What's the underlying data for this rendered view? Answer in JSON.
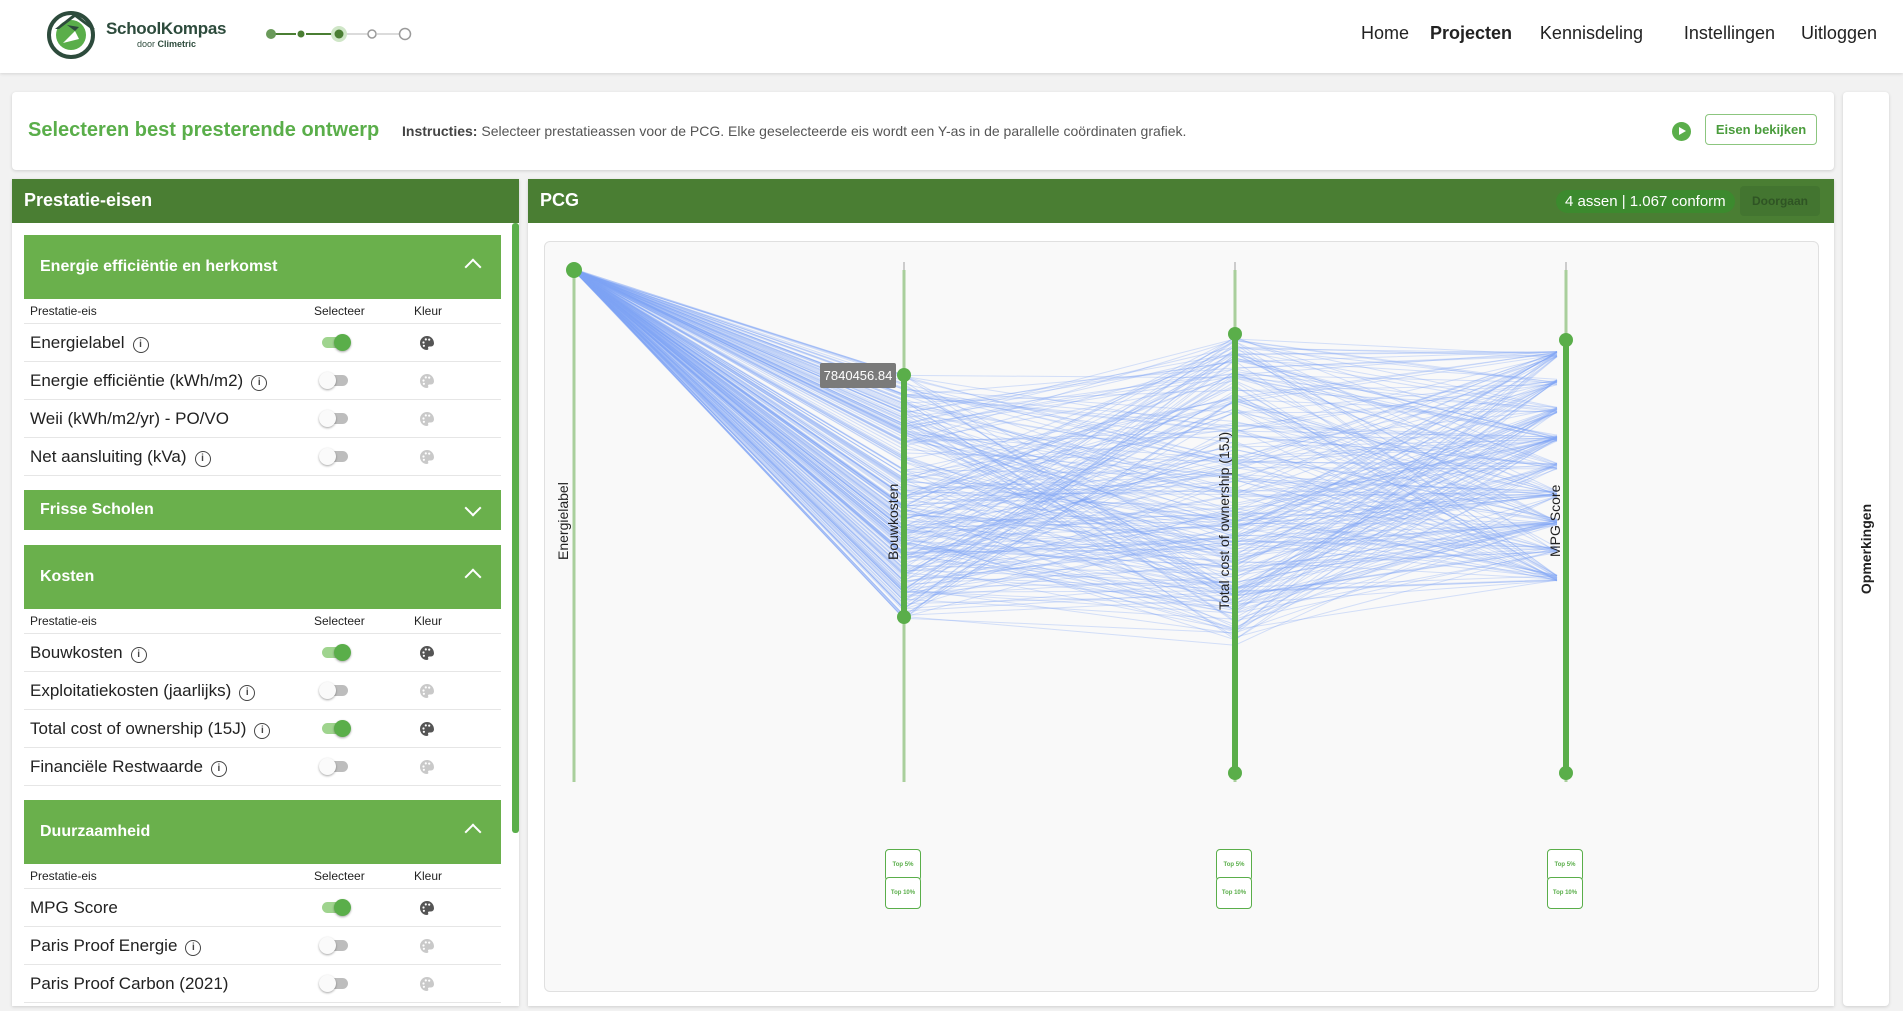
{
  "brand": {
    "name": "SchoolKompas",
    "sub_prefix": "door",
    "sub_name": "Climetric"
  },
  "nav": {
    "home": "Home",
    "projects": "Projecten",
    "knowledge": "Kennisdeling",
    "settings": "Instellingen",
    "logout": "Uitloggen",
    "active": "Projecten"
  },
  "stepper": {
    "steps": 5,
    "current": 3
  },
  "instructions": {
    "title": "Selecteren best presterende ontwerp",
    "label": "Instructies:",
    "text": "Selecteer prestatieassen voor de PCG. Elke geselecteerde eis wordt een Y-as in de parallelle coördinaten grafiek.",
    "button": "Eisen bekijken"
  },
  "side_tab": "Opmerkingen",
  "left_panel": {
    "title": "Prestatie-eisen",
    "col_eis": "Prestatie-eis",
    "col_select": "Selecteer",
    "col_color": "Kleur",
    "sections": [
      {
        "title": "Energie efficiëntie en herkomst",
        "expanded": true,
        "rows": [
          {
            "label": "Energielabel",
            "info": true,
            "selected": true
          },
          {
            "label": "Energie efficiëntie (kWh/m2)",
            "info": true,
            "selected": false
          },
          {
            "label": "Weii (kWh/m2/yr) - PO/VO",
            "info": false,
            "selected": false
          },
          {
            "label": "Net aansluiting (kVa)",
            "info": true,
            "selected": false
          }
        ]
      },
      {
        "title": "Frisse Scholen",
        "expanded": false,
        "rows": []
      },
      {
        "title": "Kosten",
        "expanded": true,
        "rows": [
          {
            "label": "Bouwkosten",
            "info": true,
            "selected": true
          },
          {
            "label": "Exploitatiekosten (jaarlijks)",
            "info": true,
            "selected": false
          },
          {
            "label": "Total cost of ownership (15J)",
            "info": true,
            "selected": true
          },
          {
            "label": "Financiële Restwaarde",
            "info": true,
            "selected": false
          }
        ]
      },
      {
        "title": "Duurzaamheid",
        "expanded": true,
        "rows": [
          {
            "label": "MPG Score",
            "info": false,
            "selected": true
          },
          {
            "label": "Paris Proof Energie",
            "info": true,
            "selected": false
          },
          {
            "label": "Paris Proof Carbon (2021)",
            "info": false,
            "selected": false
          }
        ]
      }
    ]
  },
  "pcg": {
    "title": "PCG",
    "badge": "4 assen | 1.067 conform",
    "continue_button": "Doorgaan",
    "tooltip": "7840456.84",
    "top5": "Top 5%",
    "top10": "Top 10%"
  },
  "chart_data": {
    "type": "parallel-coordinates",
    "axes": [
      "Energielabel",
      "Bouwkosten",
      "Total cost of ownership (15J)",
      "MPG Score"
    ],
    "line_color": "#7ea6f6",
    "axis_color": "#5aae4a",
    "brush_color": "#5aae4a",
    "conforming_count": "1.067",
    "hover_value": "7840456.84",
    "brushes": [
      {
        "axis": "Bouwkosten",
        "range": [
          0.2,
          0.68
        ]
      },
      {
        "axis": "Total cost of ownership (15J)",
        "range": [
          0.13,
          0.98
        ]
      },
      {
        "axis": "MPG Score",
        "range": [
          0.14,
          0.98
        ]
      }
    ]
  }
}
